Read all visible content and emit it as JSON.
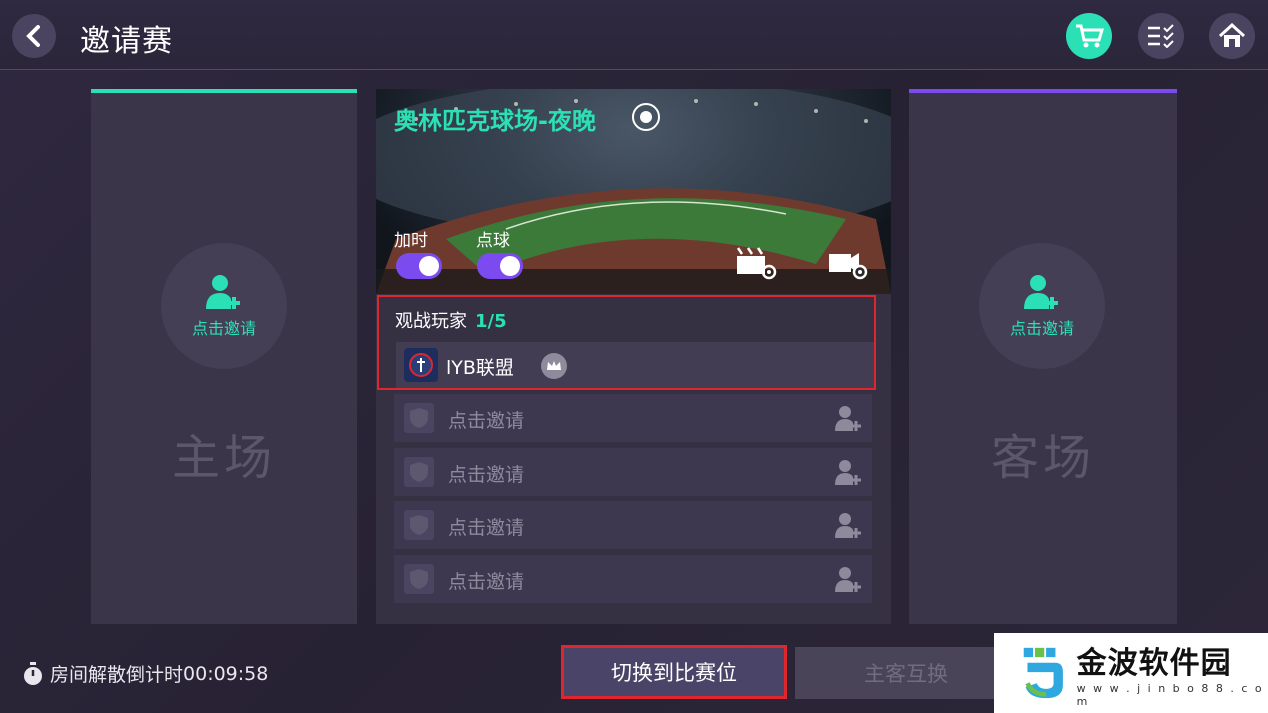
{
  "header": {
    "title": "邀请赛"
  },
  "home_panel": {
    "invite_label": "点击邀请",
    "title": "主场",
    "accent": "#2be0b4"
  },
  "away_panel": {
    "invite_label": "点击邀请",
    "title": "客场",
    "accent": "#7b4bf0"
  },
  "stadium": {
    "name": "奥林匹克球场-夜晚",
    "toggles": [
      {
        "label": "加时",
        "on": true
      },
      {
        "label": "点球",
        "on": true
      }
    ]
  },
  "spectators": {
    "label": "观战玩家",
    "count": "1/5",
    "player": {
      "name": "lYB联盟"
    },
    "slots": [
      {
        "label": "点击邀请"
      },
      {
        "label": "点击邀请"
      },
      {
        "label": "点击邀请"
      },
      {
        "label": "点击邀请"
      }
    ]
  },
  "footer": {
    "timer_label": "房间解散倒计时",
    "timer_value": "00:09:58",
    "switch_label": "切换到比赛位",
    "swap_label": "主客互换"
  },
  "watermark": {
    "title": "金波软件园",
    "url": "w w w . j i n b o 8 8 . c o m"
  },
  "colors": {
    "accent_teal": "#2be0b4",
    "accent_purple": "#7b4bf0",
    "highlight_red": "#e0262d"
  }
}
